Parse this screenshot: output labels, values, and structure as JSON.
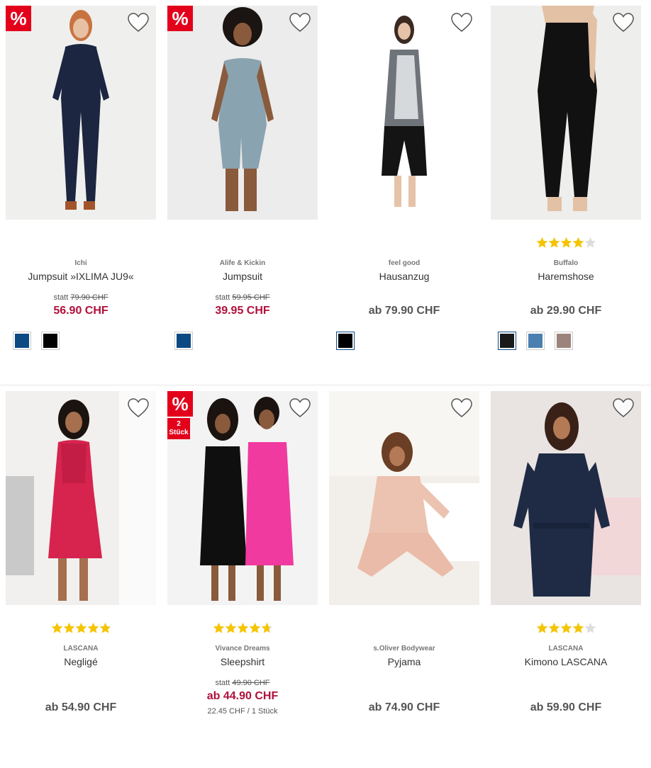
{
  "colors": {
    "sale_red": "#e3001b",
    "price_red": "#b0103b",
    "star_gold": "#f5c400",
    "star_grey": "#dddddd"
  },
  "sale_badge": "%",
  "products": [
    {
      "brand": "Ichi",
      "title": "Jumpsuit »IXLIMA JU9«",
      "old_price_prefix": "statt",
      "old_price": "79.90 CHF",
      "price": "56.90 CHF",
      "sale": true,
      "swatches": [
        "#0d4a84",
        "#000000"
      ]
    },
    {
      "brand": "Alife & Kickin",
      "title": "Jumpsuit",
      "old_price_prefix": "statt",
      "old_price": "59.95 CHF",
      "price": "39.95 CHF",
      "sale": true,
      "swatches": [
        "#0d4a84"
      ]
    },
    {
      "brand": "feel good",
      "title": "Hausanzug",
      "price": "ab 79.90 CHF",
      "sale": false,
      "swatches": [
        "#000000"
      ]
    },
    {
      "brand": "Buffalo",
      "title": "Haremshose",
      "price": "ab 29.90 CHF",
      "rating": 4,
      "sale": false,
      "swatches": [
        "#1a1a1a",
        "#4a7fb0",
        "#9c847c"
      ]
    },
    {
      "brand": "LASCANA",
      "title": "Negligé",
      "price": "ab 54.90 CHF",
      "rating": 4.9,
      "sale": false
    },
    {
      "brand": "Vivance Dreams",
      "title": "Sleepshirt",
      "old_price_prefix": "statt",
      "old_price": "49.90 CHF",
      "price": "ab 44.90 CHF",
      "unit_price": "22.45 CHF / 1 Stück",
      "rating": 4.7,
      "sale": true,
      "pack_badge": "2 Stück"
    },
    {
      "brand": "s.Oliver Bodywear",
      "title": "Pyjama",
      "price": "ab 74.90 CHF",
      "sale": false
    },
    {
      "brand": "LASCANA",
      "title": "Kimono LASCANA",
      "price": "ab 59.90 CHF",
      "rating": 4,
      "sale": false
    }
  ]
}
